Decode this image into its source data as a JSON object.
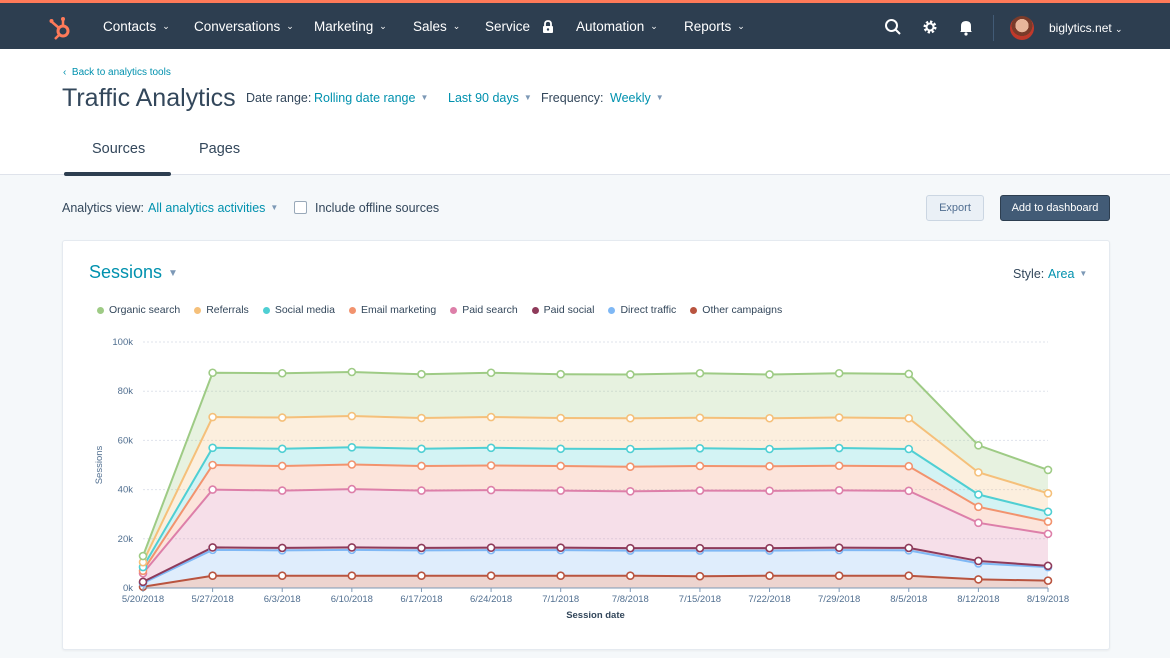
{
  "nav": {
    "items": [
      {
        "label": "Contacts",
        "dropdown": true
      },
      {
        "label": "Conversations",
        "dropdown": true
      },
      {
        "label": "Marketing",
        "dropdown": true
      },
      {
        "label": "Sales",
        "dropdown": true
      },
      {
        "label": "Service",
        "dropdown": false,
        "locked": true
      },
      {
        "label": "Automation",
        "dropdown": true
      },
      {
        "label": "Reports",
        "dropdown": true
      }
    ],
    "icons": [
      "search-icon",
      "gear-icon",
      "bell-icon"
    ],
    "account": "biglytics.net",
    "brand_color": "#ff7a59"
  },
  "header": {
    "back_link": "Back to analytics tools",
    "title": "Traffic Analytics",
    "date_range_label": "Date range:",
    "date_range_value": "Rolling date range",
    "period_value": "Last 90 days",
    "frequency_label": "Frequency:",
    "frequency_value": "Weekly",
    "tabs": [
      {
        "label": "Sources",
        "active": true
      },
      {
        "label": "Pages",
        "active": false
      }
    ]
  },
  "toolbar": {
    "analytics_view_label": "Analytics view:",
    "analytics_view_value": "All analytics activities",
    "offline_label": "Include offline sources",
    "offline_checked": false,
    "export_label": "Export",
    "add_dashboard_label": "Add to dashboard"
  },
  "card": {
    "metric": "Sessions",
    "style_label": "Style:",
    "style_value": "Area"
  },
  "chart_data": {
    "type": "area",
    "stacked": true,
    "title": "Sessions",
    "xlabel": "Session date",
    "ylabel": "Sessions",
    "ylim": [
      0,
      100000
    ],
    "yticks": [
      "0k",
      "20k",
      "40k",
      "60k",
      "80k",
      "100k"
    ],
    "ytick_values": [
      0,
      20000,
      40000,
      60000,
      80000,
      100000
    ],
    "grid": true,
    "legend_position": "top-left",
    "x": [
      "5/20/2018",
      "5/27/2018",
      "6/3/2018",
      "6/10/2018",
      "6/17/2018",
      "6/24/2018",
      "7/1/2018",
      "7/8/2018",
      "7/15/2018",
      "7/22/2018",
      "7/29/2018",
      "8/5/2018",
      "8/12/2018",
      "8/19/2018"
    ],
    "series": [
      {
        "name": "Other campaigns",
        "color": "#b9543f",
        "values": [
          500,
          5000,
          5000,
          5000,
          5000,
          5000,
          5000,
          5000,
          4800,
          5000,
          5000,
          5000,
          3500,
          3000
        ]
      },
      {
        "name": "Direct traffic",
        "color": "#7fb8f5",
        "values": [
          1500,
          10500,
          10300,
          10500,
          10300,
          10400,
          10400,
          10200,
          10400,
          10200,
          10400,
          10300,
          6500,
          5500
        ]
      },
      {
        "name": "Paid social",
        "color": "#8e3a5a",
        "values": [
          500,
          1000,
          1000,
          1000,
          1000,
          1000,
          1000,
          1000,
          1000,
          1000,
          1000,
          1000,
          1000,
          500
        ]
      },
      {
        "name": "Paid search",
        "color": "#dd7fa9",
        "values": [
          3500,
          23500,
          23300,
          23700,
          23300,
          23400,
          23200,
          23100,
          23400,
          23300,
          23300,
          23200,
          15500,
          13000
        ]
      },
      {
        "name": "Email marketing",
        "color": "#f2936e",
        "values": [
          1000,
          10000,
          10000,
          10000,
          10000,
          10000,
          10000,
          10000,
          10000,
          10000,
          10000,
          10000,
          6500,
          5000
        ]
      },
      {
        "name": "Social media",
        "color": "#4fcfd3",
        "values": [
          1500,
          7000,
          7000,
          7000,
          7000,
          7200,
          7000,
          7200,
          7200,
          7000,
          7200,
          7000,
          5000,
          4000
        ]
      },
      {
        "name": "Referrals",
        "color": "#f5c07a",
        "values": [
          2000,
          12500,
          12700,
          12700,
          12500,
          12500,
          12500,
          12500,
          12400,
          12500,
          12400,
          12500,
          9000,
          7500
        ]
      },
      {
        "name": "Organic search",
        "color": "#9ecb85",
        "values": [
          2500,
          18000,
          18000,
          17900,
          17800,
          18000,
          17800,
          17800,
          18100,
          17800,
          18000,
          18000,
          11000,
          9500
        ]
      }
    ],
    "legend_order": [
      "Organic search",
      "Referrals",
      "Social media",
      "Email marketing",
      "Paid search",
      "Paid social",
      "Direct traffic",
      "Other campaigns"
    ]
  }
}
